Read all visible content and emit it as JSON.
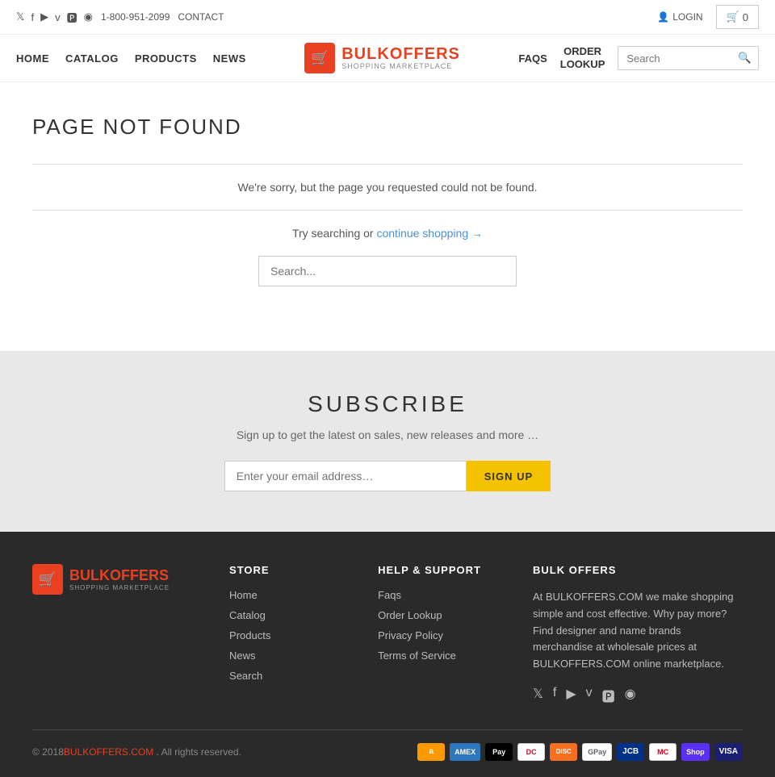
{
  "topbar": {
    "phone": "1-800-951-2099",
    "contact": "CONTACT",
    "login": "LOGIN",
    "cart_count": "0"
  },
  "header": {
    "nav": [
      "HOME",
      "CATALOG",
      "PRODUCTS",
      "NEWS"
    ],
    "logo_name": "BULKOFFERS",
    "logo_sub": "SHOPPING MARKETPLACE",
    "faqs": "FAQS",
    "order_lookup_line1": "ORDER",
    "order_lookup_line2": "LOOKUP",
    "search_placeholder": "Search"
  },
  "main": {
    "page_title": "PAGE NOT FOUND",
    "sorry_text": "We're sorry, but the page you requested could not be found.",
    "try_text": "Try searching or ",
    "continue_link": "continue shopping →",
    "search_placeholder": "Search..."
  },
  "subscribe": {
    "title": "SUBSCRIBE",
    "desc": "Sign up to get the latest on sales, new releases and more …",
    "email_placeholder": "Enter your email address…",
    "button_label": "SIGN UP"
  },
  "footer": {
    "logo_name": "BULKOFFERS",
    "logo_sub": "SHOPPING MARKETPLACE",
    "store_title": "STORE",
    "store_links": [
      "Home",
      "Catalog",
      "Products",
      "News",
      "Search"
    ],
    "help_title": "HELP & SUPPORT",
    "help_links": [
      "Faqs",
      "Order Lookup",
      "Privacy Policy",
      "Terms of Service"
    ],
    "bulk_title": "BULK OFFERS",
    "bulk_desc": "At BULKOFFERS.COM we make shopping simple and cost effective. Why pay more? Find designer and name brands merchandise at wholesale prices at BULKOFFERS.COM online marketplace.",
    "copy_year": "© 2018",
    "copy_brand": "BULKOFFERS.COM",
    "copy_rights": " . All rights reserved.",
    "payment_methods": [
      "amazon",
      "amex",
      "apple pay",
      "diners",
      "discover",
      "g pay",
      "jcb",
      "master",
      "shop pay",
      "visa"
    ]
  },
  "social_icons": [
    "𝕏",
    "f",
    "▶",
    "v",
    "𝐏",
    "◉"
  ],
  "footer_social": [
    "𝕏",
    "f",
    "▶",
    "v",
    "𝐏",
    "◉"
  ]
}
